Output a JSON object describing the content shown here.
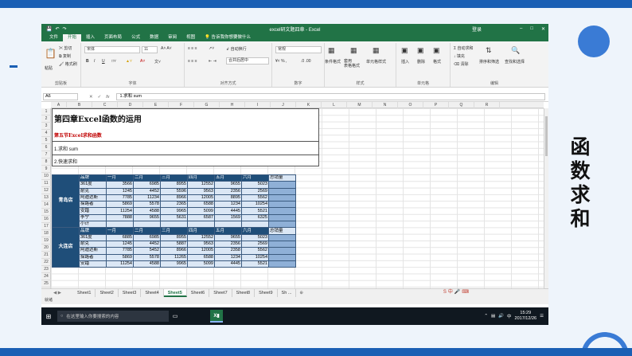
{
  "slide": {
    "side_title": "函数求和"
  },
  "titlebar": {
    "qat_icons": [
      "save-icon",
      "undo-icon",
      "redo-icon"
    ],
    "title": "excel研文题四章 - Excel",
    "login": "登录",
    "minimize": "–",
    "maximize": "□",
    "close": "✕"
  },
  "menu": {
    "tabs": [
      "文件",
      "开始",
      "插入",
      "页面布局",
      "公式",
      "数据",
      "审阅",
      "视图"
    ],
    "active": "开始",
    "tell_me": "告诉我你想要做什么"
  },
  "ribbon": {
    "paste": "粘贴",
    "cut": "剪切",
    "copy": "复制",
    "format_painter": "格式刷",
    "clipboard_label": "剪贴板",
    "font_name": "宋体",
    "font_size": "11",
    "bold": "B",
    "italic": "I",
    "underline": "U",
    "font_label": "字体",
    "wrap_text": "自动换行",
    "merge_center": "合并后居中",
    "align_label": "对齐方式",
    "number_format": "常规",
    "number_label": "数字",
    "cond_format": "条件格式",
    "table_format": "套用\n表格格式",
    "cell_styles": "单元格样式",
    "styles_label": "样式",
    "insert": "插入",
    "delete": "删除",
    "format": "格式",
    "cells_label": "单元格",
    "autosum": "自动求和",
    "fill": "填充",
    "clear": "清除",
    "sort_filter": "排序和筛选",
    "find_select": "查找和选择",
    "edit_label": "编辑"
  },
  "formula_bar": {
    "name_box": "A6",
    "fx": "fx",
    "content": "1.求和 sum"
  },
  "columns": [
    "A",
    "B",
    "C",
    "D",
    "E",
    "F",
    "G",
    "H",
    "I",
    "J",
    "K",
    "L",
    "M",
    "N",
    "O",
    "P",
    "Q",
    "R"
  ],
  "rows": [
    "1",
    "2",
    "3",
    "4",
    "5",
    "6",
    "7",
    "8",
    "9",
    "10",
    "11",
    "12",
    "13",
    "14",
    "15",
    "16",
    "17",
    "18",
    "19",
    "20",
    "21",
    "22",
    "23",
    "24",
    "25"
  ],
  "sheet_heading": {
    "title": "第四章Excel函数的运用",
    "section": "第五节Excel求和函数",
    "item1": "1.求和 sum",
    "item2": "2.快速求和"
  },
  "table1": {
    "store": "青岛店",
    "header": [
      "品牌",
      "一月",
      "二月",
      "三月",
      "四月",
      "五月",
      "六月",
      "总销量"
    ],
    "rows": [
      [
        "361度",
        "3566",
        "6985",
        "8955",
        "12552",
        "9655",
        "5023",
        ""
      ],
      [
        "耐克",
        "1245",
        "4452",
        "5596",
        "9563",
        "2356",
        "2569",
        ""
      ],
      [
        "阿迪达斯",
        "7785",
        "11234",
        "8966",
        "12005",
        "8895",
        "5562",
        ""
      ],
      [
        "探路者",
        "5869",
        "5578",
        "2365",
        "6588",
        "1234",
        "10254",
        ""
      ],
      [
        "安踏",
        "11254",
        "4588",
        "9965",
        "5099",
        "4445",
        "5521",
        ""
      ],
      [
        "李宁",
        "7888",
        "9655",
        "5631",
        "6587",
        "1569",
        "6325",
        ""
      ],
      [
        "小计",
        "",
        "",
        "",
        "",
        "",
        "",
        ""
      ]
    ]
  },
  "table2": {
    "store": "大连店",
    "header": [
      "品牌",
      "一月",
      "二月",
      "三月",
      "四月",
      "五月",
      "六月",
      "总销量"
    ],
    "rows": [
      [
        "361度",
        "6885",
        "6985",
        "8955",
        "12552",
        "9655",
        "5023",
        ""
      ],
      [
        "耐克",
        "1245",
        "4452",
        "5887",
        "9563",
        "2356",
        "2569",
        ""
      ],
      [
        "阿迪达斯",
        "7785",
        "5452",
        "8966",
        "12005",
        "2358",
        "5562",
        ""
      ],
      [
        "探路者",
        "5869",
        "5578",
        "11265",
        "6588",
        "1234",
        "10254",
        ""
      ],
      [
        "安踏",
        "11254",
        "4588",
        "9965",
        "5099",
        "4445",
        "5521",
        ""
      ]
    ]
  },
  "sheets": [
    "Sheet1",
    "Sheet2",
    "Sheet3",
    "Sheet4",
    "Sheet5",
    "Sheet6",
    "Sheet7",
    "Sheet8",
    "Sheet9",
    "Sh ..."
  ],
  "active_sheet": "Sheet5",
  "status": {
    "ready": "就绪"
  },
  "taskbar": {
    "search_placeholder": "在这里输入你要搜索的内容",
    "time": "15:29",
    "date": "2017/12/26"
  }
}
